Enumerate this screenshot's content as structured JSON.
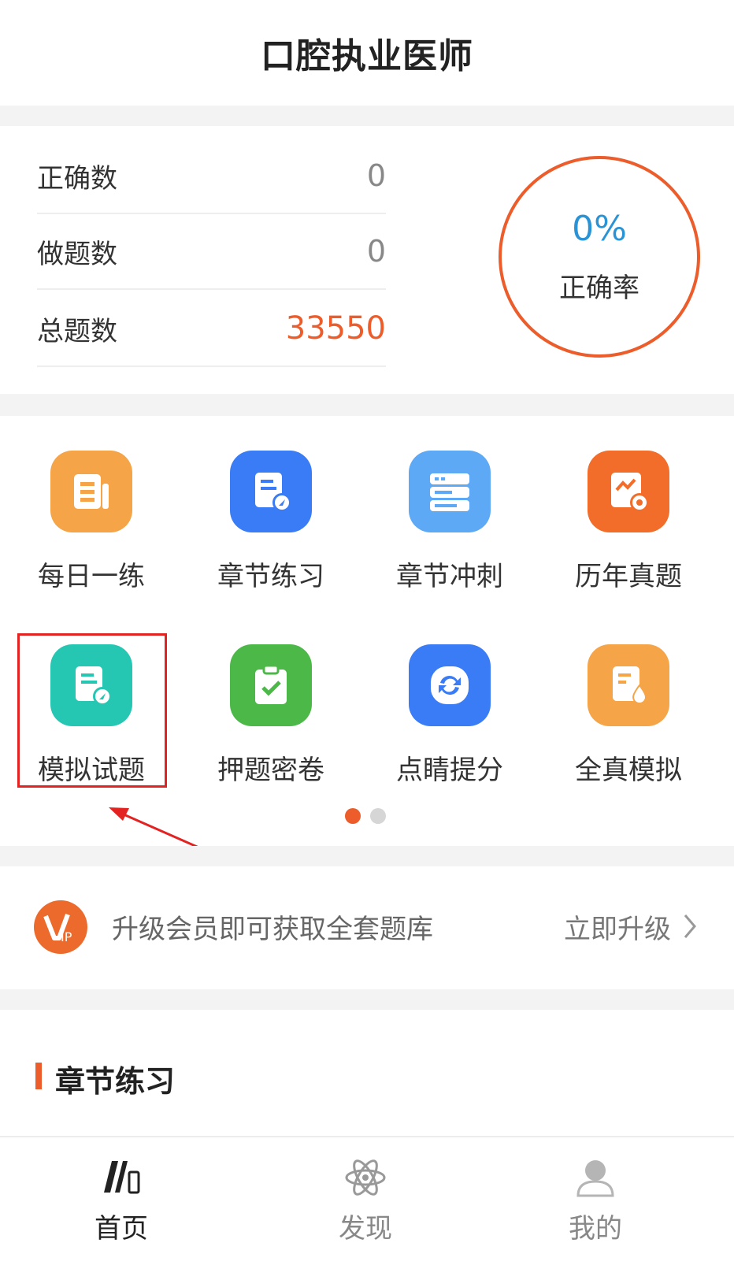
{
  "header": {
    "title": "口腔执业医师"
  },
  "stats": {
    "rows": [
      {
        "label": "正确数",
        "value": "0"
      },
      {
        "label": "做题数",
        "value": "0"
      },
      {
        "label": "总题数",
        "value": "33550"
      }
    ],
    "accuracy": {
      "value": "0%",
      "label": "正确率"
    }
  },
  "grid": {
    "items": [
      {
        "label": "每日一练",
        "icon": "daily-practice-icon",
        "color": "#f5a448"
      },
      {
        "label": "章节练习",
        "icon": "chapter-practice-icon",
        "color": "#3a7cf5"
      },
      {
        "label": "章节冲刺",
        "icon": "chapter-sprint-icon",
        "color": "#5da9f5"
      },
      {
        "label": "历年真题",
        "icon": "past-exams-icon",
        "color": "#f26d2a"
      },
      {
        "label": "模拟试题",
        "icon": "mock-test-icon",
        "color": "#25c7b3"
      },
      {
        "label": "押题密卷",
        "icon": "predicted-paper-icon",
        "color": "#4cb848"
      },
      {
        "label": "点睛提分",
        "icon": "score-boost-icon",
        "color": "#3a7cf5"
      },
      {
        "label": "全真模拟",
        "icon": "full-simulation-icon",
        "color": "#f5a448"
      }
    ],
    "page_dots": {
      "active": 1,
      "total": 2
    }
  },
  "vip": {
    "badge": "VIP",
    "text": "升级会员即可获取全套题库",
    "link": "立即升级"
  },
  "section": {
    "title": "章节练习"
  },
  "tabbar": {
    "tabs": [
      {
        "label": "首页",
        "icon": "books-icon",
        "active": true
      },
      {
        "label": "发现",
        "icon": "atom-icon",
        "active": false
      },
      {
        "label": "我的",
        "icon": "user-icon",
        "active": false
      }
    ]
  },
  "colors": {
    "accent": "#ec5d2b",
    "percent": "#2a93d6",
    "highlight": "#e32222"
  }
}
